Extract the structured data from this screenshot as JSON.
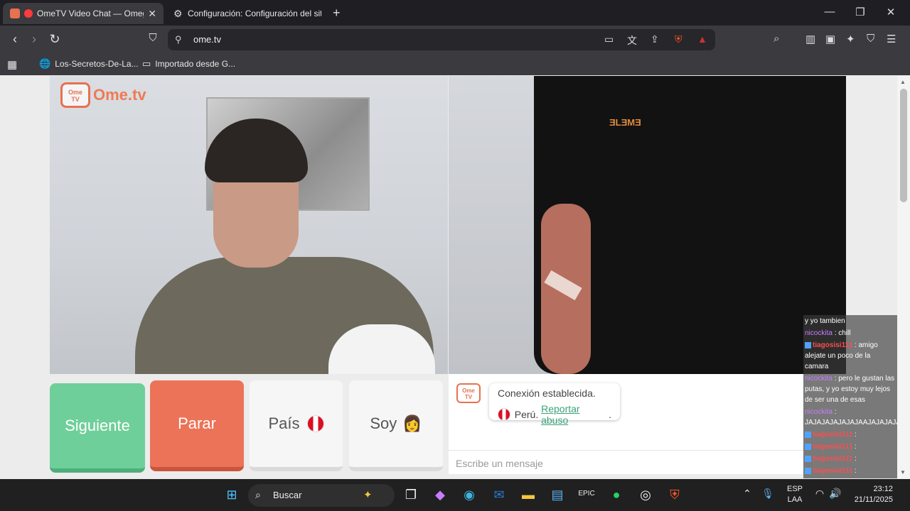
{
  "browser": {
    "tabs": [
      {
        "label": "OmeTV Video Chat — Omegl",
        "active": true
      },
      {
        "label": "Configuración: Configuración del sitio",
        "active": false
      }
    ],
    "url": "ome.tv",
    "bookmarks": [
      {
        "label": "Los-Secretos-De-La..."
      },
      {
        "label": "Importado desde G..."
      }
    ],
    "shield_badge": "2"
  },
  "page": {
    "logo_text": "Ome.tv",
    "logo_small": "Ome\nTV",
    "buttons": {
      "next": "Siguiente",
      "stop": "Parar",
      "country": "País",
      "gender": "Soy",
      "gender_emoji": "👩"
    },
    "system_message": {
      "line1": "Conexión establecida.",
      "country": "Perú.",
      "report_link": "Reportar abuso",
      "after_link": "."
    },
    "input_placeholder": "Escribe un mensaje",
    "shirt_text": "ƎLƎMƎ"
  },
  "overlay_chat": [
    {
      "user": "",
      "text": "y yo tambien",
      "type": "partial"
    },
    {
      "user": "nicockita",
      "text": ": chill",
      "type": "u1"
    },
    {
      "user": "tiagosisi111",
      "text": ": amigo alejate un poco de la camara",
      "type": "u2"
    },
    {
      "user": "nicockita",
      "text": ": pero le gustan las putas, y yo estoy muy lejos de ser una de esas",
      "type": "u1"
    },
    {
      "user": "nicockita",
      "text": ": JAJAJAJAJAJAJAAJAJAJAJA",
      "type": "u1"
    },
    {
      "user": "tiagosisi111",
      "text": ":",
      "type": "u2"
    },
    {
      "user": "tiagosisi111",
      "text": ":",
      "type": "u2"
    },
    {
      "user": "tiagosisi111",
      "text": ":",
      "type": "u2"
    },
    {
      "user": "tiagosisi111",
      "text": ":",
      "type": "u2"
    },
    {
      "user": "tiagosisi111",
      "text": ":",
      "type": "u2"
    }
  ],
  "taskbar": {
    "search_label": "Buscar",
    "lang1": "ESP",
    "lang2": "LAA",
    "time": "23:12",
    "date": "21/11/2025"
  }
}
